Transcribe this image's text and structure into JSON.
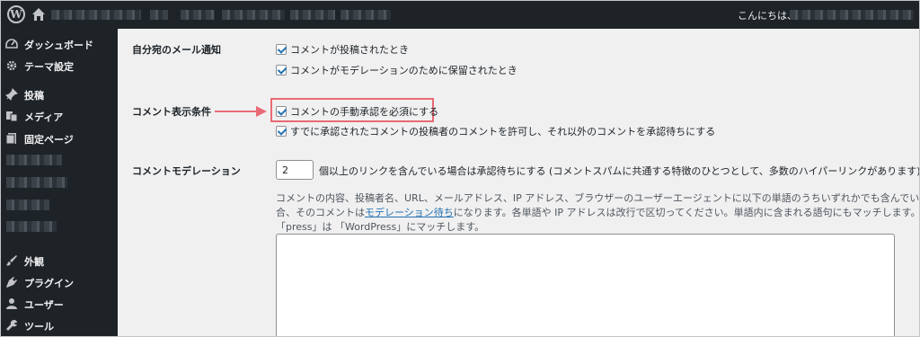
{
  "adminbar": {
    "greeting": "こんにちは、"
  },
  "sidebar": {
    "items": [
      {
        "label": "ダッシュボード",
        "icon": "dashboard-icon"
      },
      {
        "label": "テーマ設定",
        "icon": "gear-icon"
      },
      {
        "label": "投稿",
        "icon": "pin-icon"
      },
      {
        "label": "メディア",
        "icon": "media-icon"
      },
      {
        "label": "固定ページ",
        "icon": "page-icon"
      },
      {
        "label": "外観",
        "icon": "brush-icon"
      },
      {
        "label": "プラグイン",
        "icon": "plug-icon"
      },
      {
        "label": "ユーザー",
        "icon": "user-icon"
      },
      {
        "label": "ツール",
        "icon": "wrench-icon"
      }
    ]
  },
  "settings": {
    "email_section": {
      "label": "自分宛のメール通知",
      "options": [
        {
          "text": "コメントが投稿されたとき",
          "checked": true
        },
        {
          "text": "コメントがモデレーションのために保留されたとき",
          "checked": true
        }
      ]
    },
    "display_section": {
      "label": "コメント表示条件",
      "options": [
        {
          "text": "コメントの手動承認を必須にする",
          "checked": true
        },
        {
          "text": "すでに承認されたコメントの投稿者のコメントを許可し、それ以外のコメントを承認待ちにする",
          "checked": true
        }
      ]
    },
    "moderation_section": {
      "label": "コメントモデレーション",
      "link_count": "2",
      "link_count_suffix": "個以上のリンクを含んでいる場合は承認待ちにする (コメントスパムに共通する特徴のひとつとして、多数のハイパーリンクがあります)。",
      "desc_line1": "コメントの内容、投稿者名、URL、メールアドレス、IP アドレス、ブラウザーのユーザーエージェントに以下の単語のうちいずれかでも含んでいる場",
      "desc_line2_pre": "合、そのコメントは",
      "desc_link": "モデレーション待ち",
      "desc_line2_post": "になります。各単語や IP アドレスは改行で区切ってください。単語内に含まれる語句にもマッチします。例:",
      "desc_line3": "「press」は 「WordPress」にマッチします。"
    }
  }
}
